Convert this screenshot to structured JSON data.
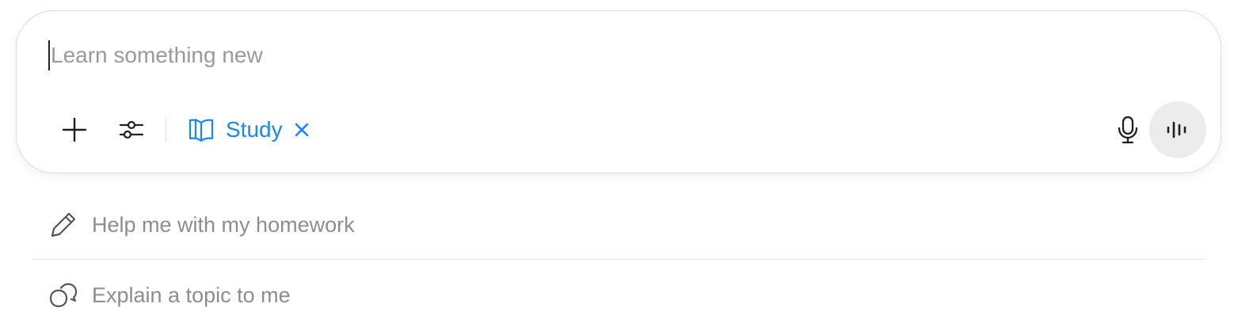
{
  "composer": {
    "placeholder": "Learn something new",
    "value": "",
    "mode_chip": {
      "label": "Study",
      "icon": "book-open-icon",
      "close_icon": "close-icon",
      "color": "#1a86f0"
    },
    "left_actions": [
      {
        "icon": "plus-icon"
      },
      {
        "icon": "sliders-icon"
      }
    ],
    "right_actions": [
      {
        "icon": "microphone-icon"
      },
      {
        "icon": "voice-waveform-icon"
      }
    ]
  },
  "suggestions": [
    {
      "icon": "pencil-icon",
      "label": "Help me with my homework"
    },
    {
      "icon": "speech-bubbles-icon",
      "label": "Explain a topic to me"
    }
  ]
}
